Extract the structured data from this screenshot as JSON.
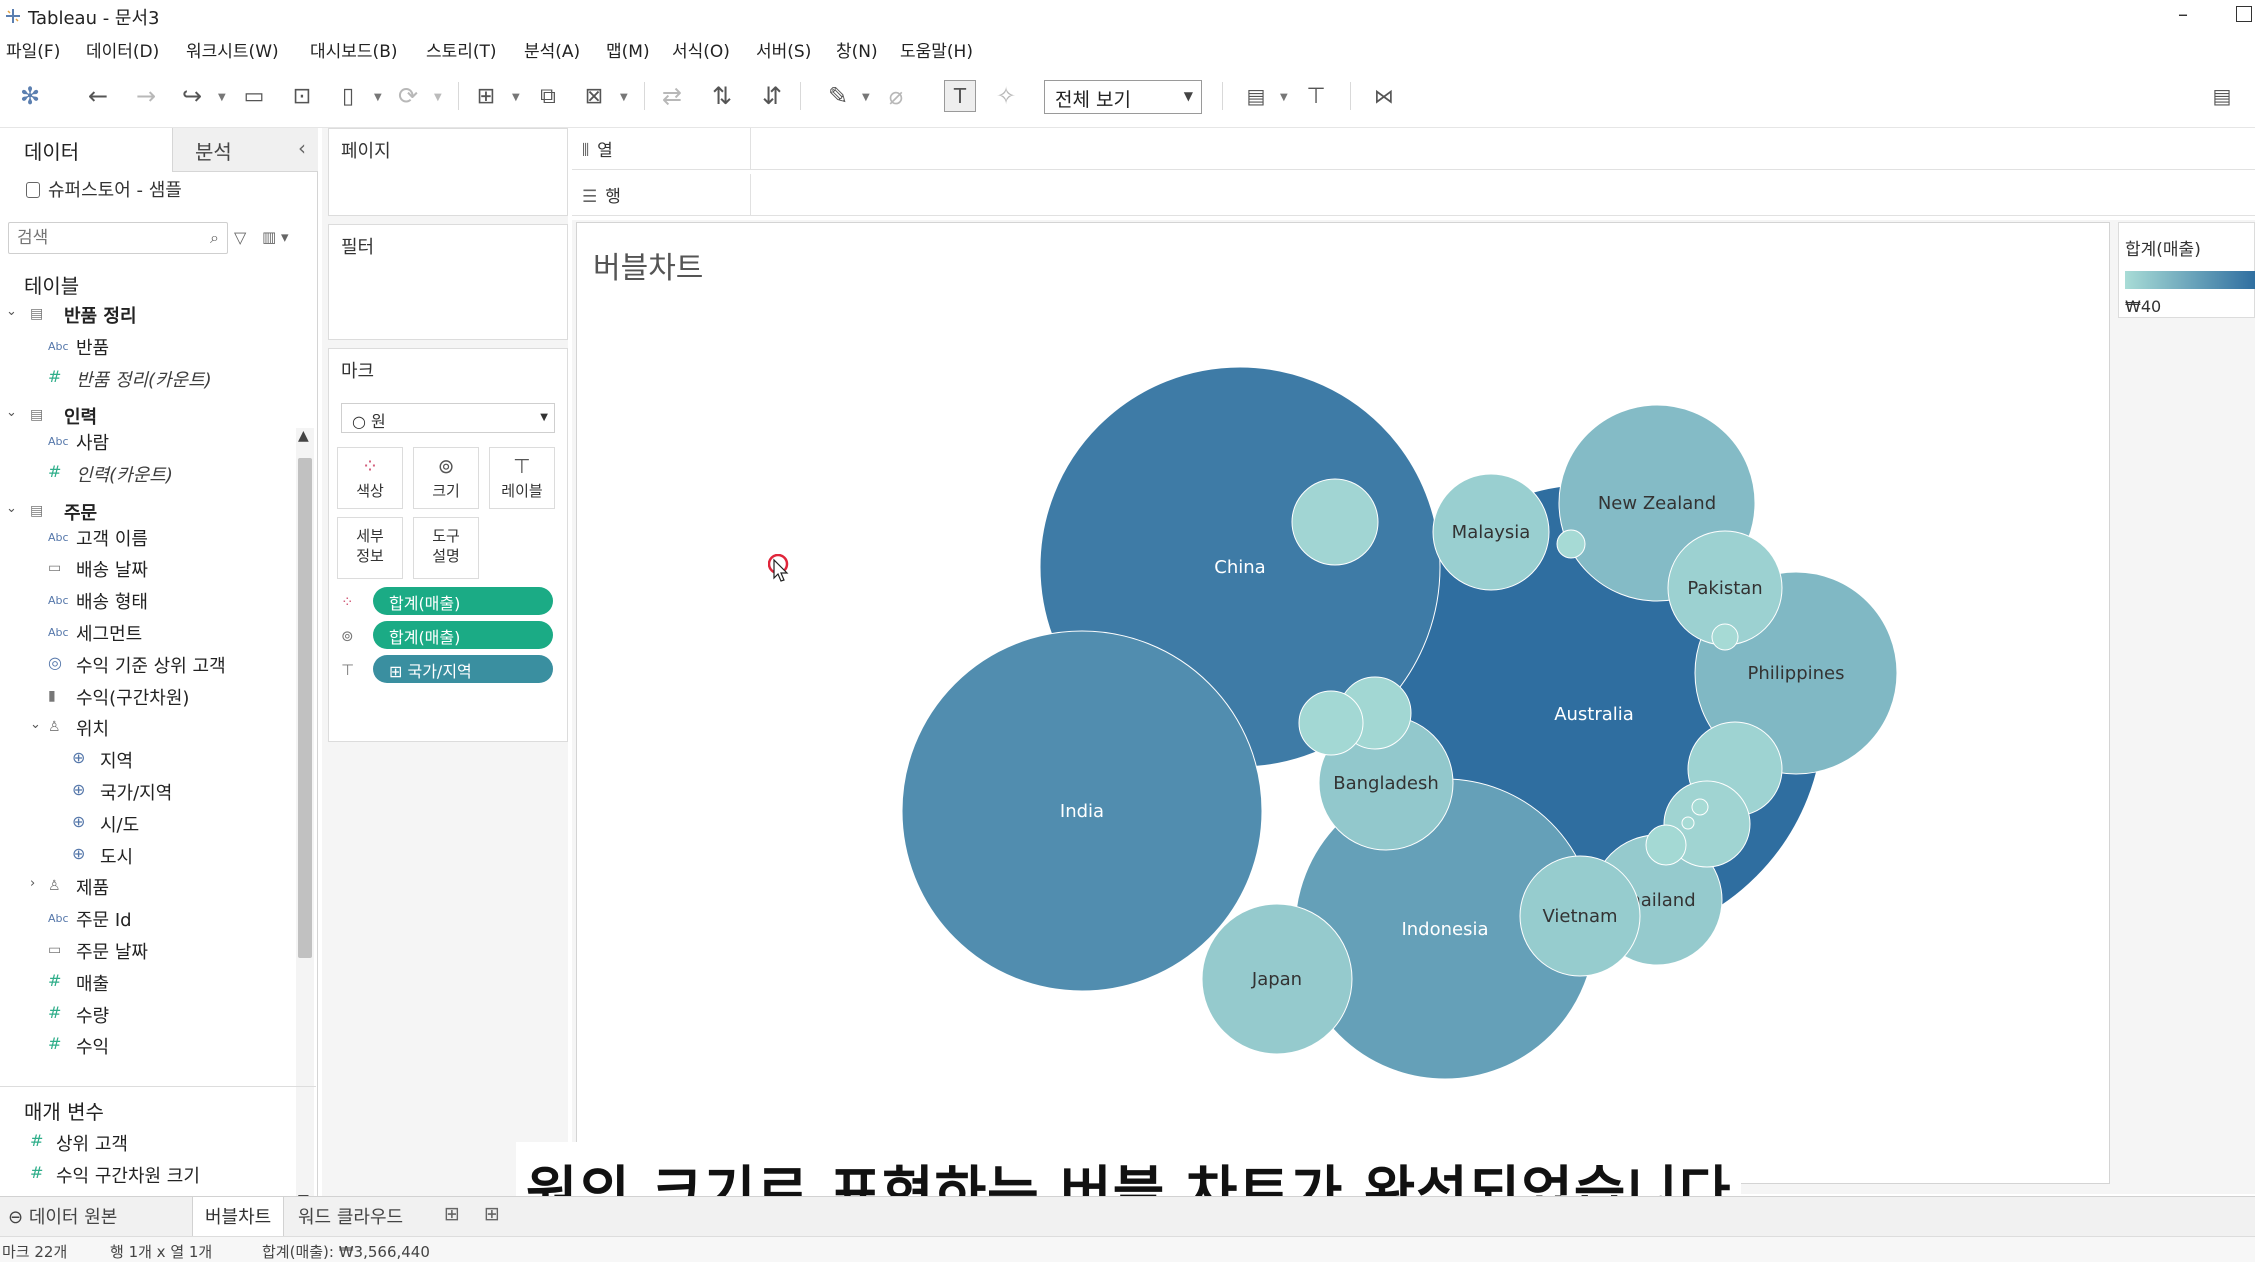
{
  "window": {
    "title": "Tableau - 문서3"
  },
  "menu": [
    "파일(F)",
    "데이터(D)",
    "워크시트(W)",
    "대시보드(B)",
    "스토리(T)",
    "분석(A)",
    "맵(M)",
    "서식(O)",
    "서버(S)",
    "창(N)",
    "도움말(H)"
  ],
  "toolbar": {
    "fit_label": "전체 보기"
  },
  "data_pane": {
    "tab_data": "데이터",
    "tab_analysis": "분석",
    "datasource": "슈퍼스토어 - 샘플",
    "search_placeholder": "검색",
    "tables_heading": "테이블",
    "fields": [
      {
        "kind": "group",
        "label": "반품 정리"
      },
      {
        "kind": "dim",
        "label": "반품"
      },
      {
        "kind": "measure",
        "label": "반품 정리(카운트)",
        "italic": true
      },
      {
        "kind": "group",
        "label": "인력"
      },
      {
        "kind": "dim",
        "label": "사람"
      },
      {
        "kind": "measure",
        "label": "인력(카운트)",
        "italic": true
      },
      {
        "kind": "group",
        "label": "주문"
      },
      {
        "kind": "dim",
        "label": "고객 이름"
      },
      {
        "kind": "date",
        "label": "배송 날짜"
      },
      {
        "kind": "dim",
        "label": "배송 형태"
      },
      {
        "kind": "dim",
        "label": "세그먼트"
      },
      {
        "kind": "set",
        "label": "수익 기준 상위 고객"
      },
      {
        "kind": "bin",
        "label": "수익(구간차원)"
      },
      {
        "kind": "hier",
        "label": "위치"
      },
      {
        "kind": "geo",
        "label": "지역"
      },
      {
        "kind": "geo",
        "label": "국가/지역"
      },
      {
        "kind": "geo",
        "label": "시/도"
      },
      {
        "kind": "geo",
        "label": "도시"
      },
      {
        "kind": "hier-collapsed",
        "label": "제품"
      },
      {
        "kind": "dim",
        "label": "주문 Id"
      },
      {
        "kind": "date",
        "label": "주문 날짜"
      },
      {
        "kind": "measure",
        "label": "매출"
      },
      {
        "kind": "measure",
        "label": "수량"
      },
      {
        "kind": "measure",
        "label": "수익"
      }
    ],
    "params_heading": "매개 변수",
    "params": [
      "상위 고객",
      "수익 구간차원 크기"
    ]
  },
  "shelves": {
    "pages": "페이지",
    "filters": "필터",
    "marks": "마크",
    "mark_type": "원",
    "buttons": {
      "color": "색상",
      "size": "크기",
      "label": "레이블",
      "detail": "세부\n정보",
      "tooltip": "도구\n설명"
    },
    "pills": [
      {
        "icon": "color-icon",
        "label": "합계(매출)"
      },
      {
        "icon": "size-icon",
        "label": "합계(매출)"
      },
      {
        "icon": "label-icon",
        "label": "⊞ 국가/지역"
      }
    ],
    "columns": "열",
    "rows": "행"
  },
  "worksheet": {
    "title": "버블차트"
  },
  "legend": {
    "title": "합계(매출)",
    "min_label": "₩40",
    "colors": [
      "#a8dcd6",
      "#2f6ea0"
    ]
  },
  "chart_data": {
    "type": "bubble",
    "title": "버블차트",
    "size_and_color_measure": "합계(매출)",
    "bubbles": [
      {
        "label": "Australia",
        "rank": 1,
        "shade": 1.0
      },
      {
        "label": "China",
        "rank": 2,
        "shade": 0.88
      },
      {
        "label": "India",
        "rank": 3,
        "shade": 0.72
      },
      {
        "label": "Indonesia",
        "rank": 4,
        "shade": 0.55
      },
      {
        "label": "Philippines",
        "rank": 5,
        "shade": 0.33
      },
      {
        "label": "New Zealand",
        "rank": 6,
        "shade": 0.3
      },
      {
        "label": "Japan",
        "rank": 7,
        "shade": 0.16
      },
      {
        "label": "Bangladesh",
        "rank": 8,
        "shade": 0.18
      },
      {
        "label": "Thailand",
        "rank": 9,
        "shade": 0.16
      },
      {
        "label": "Vietnam",
        "rank": 10,
        "shade": 0.15
      },
      {
        "label": "Malaysia",
        "rank": 11,
        "shade": 0.12
      },
      {
        "label": "Pakistan",
        "rank": 12,
        "shade": 0.1
      },
      {
        "label": "",
        "rank": 13,
        "shade": 0.08
      },
      {
        "label": "",
        "rank": 14,
        "shade": 0.07
      },
      {
        "label": "",
        "rank": 15,
        "shade": 0.06
      },
      {
        "label": "",
        "rank": 16,
        "shade": 0.05
      },
      {
        "label": "",
        "rank": 17,
        "shade": 0.04
      },
      {
        "label": "",
        "rank": 18,
        "shade": 0.03
      },
      {
        "label": "",
        "rank": 19,
        "shade": 0.02
      },
      {
        "label": "",
        "rank": 20,
        "shade": 0.02
      },
      {
        "label": "",
        "rank": 21,
        "shade": 0.01
      },
      {
        "label": "",
        "rank": 22,
        "shade": 0.01
      }
    ]
  },
  "caption": "원의 크기로 표현하는 버블 차트가 완성되었습니다",
  "tabs": {
    "datasource": "데이터 원본",
    "sheets": [
      "버블차트",
      "워드 클라우드"
    ]
  },
  "status": {
    "marks": "마크 22개",
    "rowcol": "행 1개 x 열 1개",
    "sum": "합계(매출): ₩3,566,440"
  }
}
